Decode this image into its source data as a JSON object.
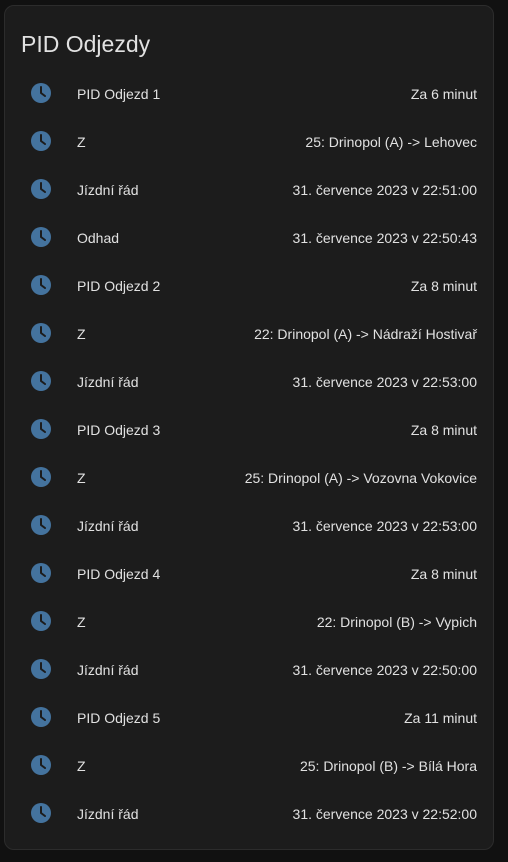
{
  "card": {
    "title": "PID Odjezdy"
  },
  "theme": {
    "icon_color": "#44739e",
    "background": "#111111",
    "card_background": "#1c1c1c",
    "text_color": "#e1e1e1"
  },
  "rows": [
    {
      "icon": "clock-icon",
      "label": "PID Odjezd 1",
      "value": "Za 6 minut"
    },
    {
      "icon": "clock-icon",
      "label": "Z",
      "value": "25: Drinopol (A) -> Lehovec"
    },
    {
      "icon": "clock-icon",
      "label": "Jízdní řád",
      "value": "31. července 2023 v 22:51:00"
    },
    {
      "icon": "clock-icon",
      "label": "Odhad",
      "value": "31. července 2023 v 22:50:43"
    },
    {
      "icon": "clock-icon",
      "label": "PID Odjezd 2",
      "value": "Za 8 minut"
    },
    {
      "icon": "clock-icon",
      "label": "Z",
      "value": "22: Drinopol (A) -> Nádraží Hostivař"
    },
    {
      "icon": "clock-icon",
      "label": "Jízdní řád",
      "value": "31. července 2023 v 22:53:00"
    },
    {
      "icon": "clock-icon",
      "label": "PID Odjezd 3",
      "value": "Za 8 minut"
    },
    {
      "icon": "clock-icon",
      "label": "Z",
      "value": "25: Drinopol (A) -> Vozovna Vokovice"
    },
    {
      "icon": "clock-icon",
      "label": "Jízdní řád",
      "value": "31. července 2023 v 22:53:00"
    },
    {
      "icon": "clock-icon",
      "label": "PID Odjezd 4",
      "value": "Za 8 minut"
    },
    {
      "icon": "clock-icon",
      "label": "Z",
      "value": "22: Drinopol (B) -> Vypich"
    },
    {
      "icon": "clock-icon",
      "label": "Jízdní řád",
      "value": "31. července 2023 v 22:50:00"
    },
    {
      "icon": "clock-icon",
      "label": "PID Odjezd 5",
      "value": "Za 11 minut"
    },
    {
      "icon": "clock-icon",
      "label": "Z",
      "value": "25: Drinopol (B) -> Bílá Hora"
    },
    {
      "icon": "clock-icon",
      "label": "Jízdní řád",
      "value": "31. července 2023 v 22:52:00"
    }
  ]
}
